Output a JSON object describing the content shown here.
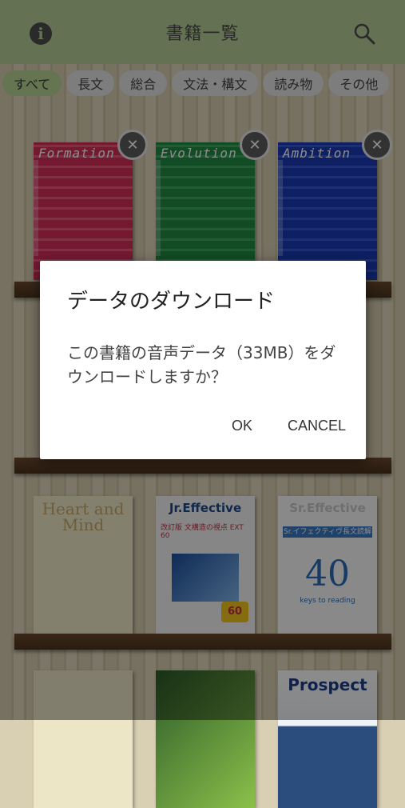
{
  "header": {
    "title": "書籍一覧",
    "info_icon": "info-icon",
    "search_icon": "search-icon"
  },
  "tabs": [
    {
      "label": "すべて",
      "active": true
    },
    {
      "label": "長文"
    },
    {
      "label": "総合"
    },
    {
      "label": "文法・構文"
    },
    {
      "label": "読み物"
    },
    {
      "label": "その他"
    }
  ],
  "books": {
    "row1": [
      "Formation",
      "Evolution",
      "Ambition"
    ],
    "row3": [
      {
        "title": "Heart and Mind"
      },
      {
        "title": "Jr.Effective",
        "subtitle": "改訂版 文構造の視点 EXT 60",
        "badge": "60"
      },
      {
        "title": "Sr.Effective",
        "subtitle": "Sr.イフェクティヴ長文読解",
        "number": "40",
        "tagline": "keys to reading"
      }
    ],
    "row4": [
      {
        "title": ""
      },
      {
        "title": ""
      },
      {
        "title": "Prospect"
      }
    ]
  },
  "dialog": {
    "title": "データのダウンロード",
    "message": "この書籍の音声データ（33MB）をダウンロードしますか？",
    "ok": "OK",
    "cancel": "CANCEL"
  }
}
